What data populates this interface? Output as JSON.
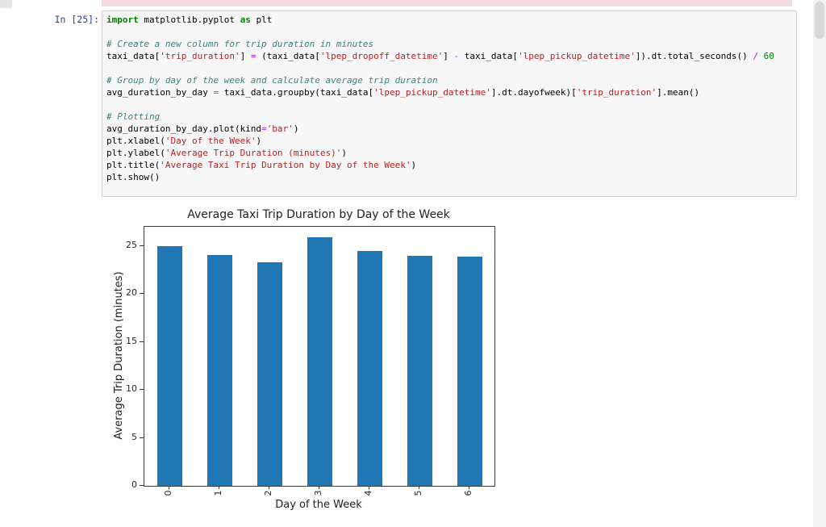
{
  "page": {
    "prev_cell_remnant_color": "#f5dbdb",
    "cell_background": "#f7f7f7",
    "cell_border": "#cfcfcf",
    "prompt_color": "#303F9F"
  },
  "cell": {
    "prompt": "In [25]:",
    "code_lines": [
      [
        [
          "k",
          "import"
        ],
        [
          "p",
          " matplotlib.pyplot "
        ],
        [
          "k",
          "as"
        ],
        [
          "p",
          " plt"
        ]
      ],
      [],
      [
        [
          "c",
          "# Create a new column for trip duration in minutes"
        ]
      ],
      [
        [
          "p",
          "taxi_data["
        ],
        [
          "s",
          "'trip_duration'"
        ],
        [
          "p",
          "] "
        ],
        [
          "o",
          "="
        ],
        [
          "p",
          " (taxi_data["
        ],
        [
          "s",
          "'lpep_dropoff_datetime'"
        ],
        [
          "p",
          "] "
        ],
        [
          "o",
          "-"
        ],
        [
          "p",
          " taxi_data["
        ],
        [
          "s",
          "'lpep_pickup_datetime'"
        ],
        [
          "p",
          "]).dt.total_seconds() "
        ],
        [
          "o",
          "/"
        ],
        [
          "p",
          " "
        ],
        [
          "n",
          "60"
        ]
      ],
      [],
      [
        [
          "c",
          "# Group by day of the week and calculate average trip duration"
        ]
      ],
      [
        [
          "p",
          "avg_duration_by_day "
        ],
        [
          "o",
          "="
        ],
        [
          "p",
          " taxi_data.groupby(taxi_data["
        ],
        [
          "s",
          "'lpep_pickup_datetime'"
        ],
        [
          "p",
          "].dt.dayofweek)["
        ],
        [
          "s",
          "'trip_duration'"
        ],
        [
          "p",
          "].mean()"
        ]
      ],
      [],
      [
        [
          "c",
          "# Plotting"
        ]
      ],
      [
        [
          "p",
          "avg_duration_by_day.plot(kind"
        ],
        [
          "o",
          "="
        ],
        [
          "s",
          "'bar'"
        ],
        [
          "p",
          ")"
        ]
      ],
      [
        [
          "p",
          "plt.xlabel("
        ],
        [
          "s",
          "'Day of the Week'"
        ],
        [
          "p",
          ")"
        ]
      ],
      [
        [
          "p",
          "plt.ylabel("
        ],
        [
          "s",
          "'Average Trip Duration (minutes)'"
        ],
        [
          "p",
          ")"
        ]
      ],
      [
        [
          "p",
          "plt.title("
        ],
        [
          "s",
          "'Average Taxi Trip Duration by Day of the Week'"
        ],
        [
          "p",
          ")"
        ]
      ],
      [
        [
          "p",
          "plt.show()"
        ]
      ],
      []
    ]
  },
  "chart_data": {
    "type": "bar",
    "title": "Average Taxi Trip Duration by Day of the Week",
    "xlabel": "Day of the Week",
    "ylabel": "Average Trip Duration (minutes)",
    "categories": [
      "0",
      "1",
      "2",
      "3",
      "4",
      "5",
      "6"
    ],
    "values": [
      25.0,
      24.1,
      23.3,
      25.9,
      24.5,
      24.0,
      23.9
    ],
    "ylim": [
      0,
      27
    ],
    "yticks": [
      0,
      5,
      10,
      15,
      20,
      25
    ],
    "bar_color": "#1f77b4",
    "grid": false,
    "legend": "none",
    "xtick_rotation": 90
  }
}
